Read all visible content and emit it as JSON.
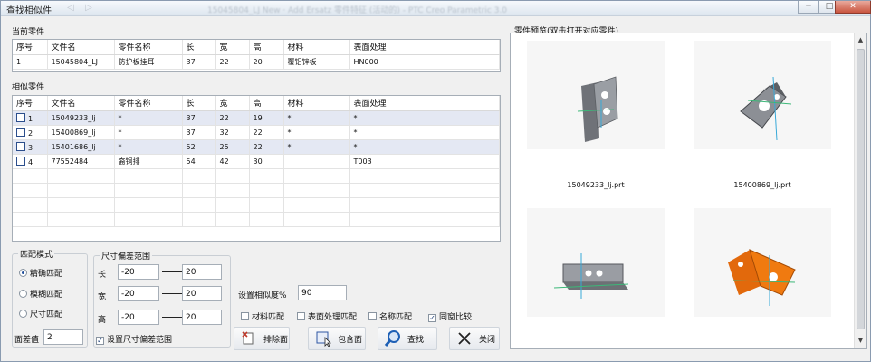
{
  "window": {
    "title": "查找相似件",
    "blurred_title": "15045804_LJ New · Add Ersatz 零件特征 (活动的) - PTC Creo Parametric 3.0",
    "controls": {
      "minimize": "─",
      "maximize": "□",
      "close": "✕"
    }
  },
  "current_part": {
    "section_label": "当前零件",
    "columns": [
      "序号",
      "文件名",
      "零件名称",
      "长",
      "宽",
      "高",
      "材料",
      "表面处理"
    ],
    "rows": [
      [
        "1",
        "15045804_LJ",
        "防护板挂耳",
        "37",
        "22",
        "20",
        "覆铝锌板",
        "HN000"
      ]
    ]
  },
  "similar_parts": {
    "section_label": "相似零件",
    "columns": [
      "序号",
      "文件名",
      "零件名称",
      "长",
      "宽",
      "高",
      "材料",
      "表面处理"
    ],
    "rows": [
      [
        "1",
        "15049233_lj",
        "*",
        "37",
        "22",
        "19",
        "*",
        "*"
      ],
      [
        "2",
        "15400869_lj",
        "*",
        "37",
        "32",
        "22",
        "*",
        "*"
      ],
      [
        "3",
        "15401686_lj",
        "*",
        "52",
        "25",
        "22",
        "*",
        "*"
      ],
      [
        "4",
        "77552484",
        "裔铜排",
        "54",
        "42",
        "30",
        "",
        "T003"
      ]
    ]
  },
  "match_mode": {
    "legend": "匹配模式",
    "options": [
      "精确匹配",
      "模糊匹配",
      "尺寸匹配"
    ],
    "selected": "精确匹配",
    "tolerance_label": "面差值",
    "tolerance_value": "2"
  },
  "dimension_range": {
    "legend": "尺寸偏差范围",
    "rows": [
      {
        "label": "长",
        "min": "-20",
        "max": "20"
      },
      {
        "label": "宽",
        "min": "-20",
        "max": "20"
      },
      {
        "label": "高",
        "min": "-20",
        "max": "20"
      }
    ],
    "set_range_label": "设置尺寸偏差范围",
    "set_range_checked": true
  },
  "similarity": {
    "label": "设置相似度%",
    "value": "90"
  },
  "match_options": [
    {
      "label": "材料匹配",
      "checked": false
    },
    {
      "label": "表面处理匹配",
      "checked": false
    },
    {
      "label": "名称匹配",
      "checked": false
    },
    {
      "label": "同窗比较",
      "checked": true
    }
  ],
  "buttons": {
    "exclude": "排除面",
    "include": "包含面",
    "search": "查找",
    "close": "关闭"
  },
  "preview": {
    "label": "零件预览(双击打开对应零件)",
    "items": [
      {
        "caption": "15049233_lj.prt",
        "color": "#8c8f95"
      },
      {
        "caption": "15400869_lj.prt",
        "color": "#8c8f95"
      },
      {
        "caption": "",
        "color": "#9a9da3"
      },
      {
        "caption": "",
        "color": "#f07a10"
      }
    ]
  }
}
